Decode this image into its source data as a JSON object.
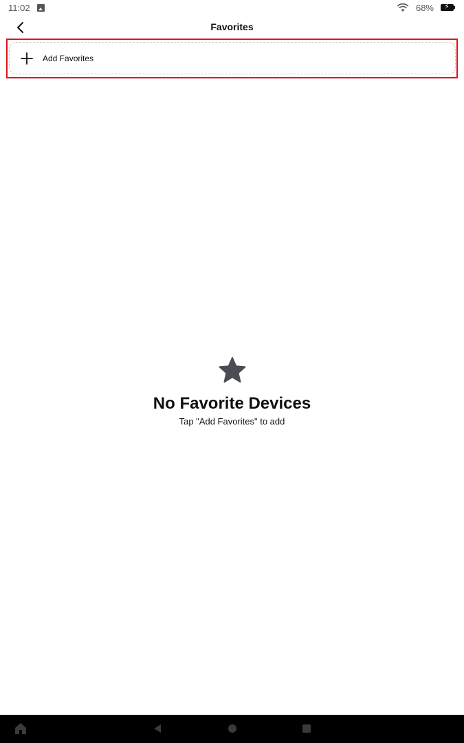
{
  "status_bar": {
    "time": "11:02",
    "battery": "68%"
  },
  "header": {
    "title": "Favorites"
  },
  "add_favorites": {
    "label": "Add Favorites",
    "highlight_color": "#e4141b"
  },
  "empty_state": {
    "title": "No Favorite Devices",
    "subtitle": "Tap \"Add Favorites\" to add"
  },
  "icons": {
    "back": "chevron-left-icon",
    "add": "plus-icon",
    "empty": "star-icon",
    "wifi": "wifi-icon",
    "battery": "battery-charging-icon"
  }
}
